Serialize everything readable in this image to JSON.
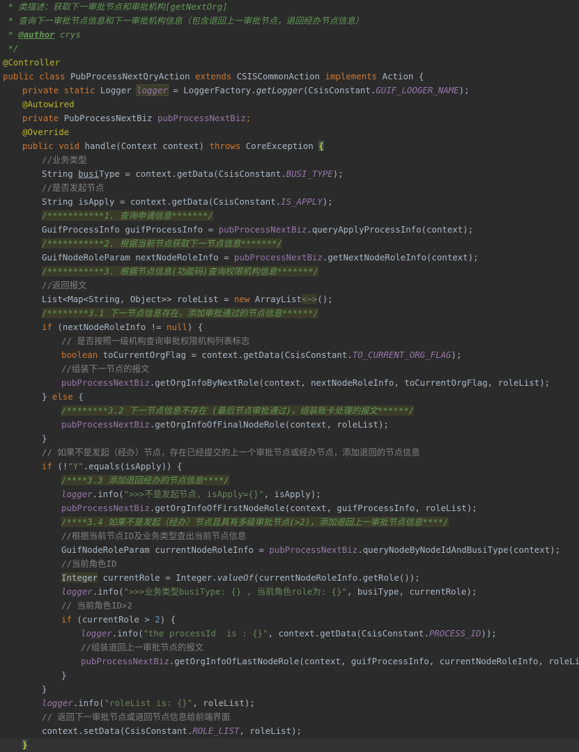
{
  "code_lines": [
    {
      "indent": 0,
      "tokens": [
        {
          "t": "doc",
          "v": " * 类描述：获取下一审批节点和审批机构[getNextOrg]"
        }
      ]
    },
    {
      "indent": 0,
      "tokens": [
        {
          "t": "doc",
          "v": " * 查询下一审批节点信息和下一审批机构信息（包含退回上一审批节点，退回经办节点信息）"
        }
      ]
    },
    {
      "indent": 0,
      "tokens": [
        {
          "t": "doc",
          "v": " * "
        },
        {
          "t": "doctag",
          "v": "@author"
        },
        {
          "t": "doc",
          "v": " crys"
        }
      ]
    },
    {
      "indent": 0,
      "tokens": [
        {
          "t": "doc",
          "v": " */"
        }
      ]
    },
    {
      "indent": 0,
      "tokens": [
        {
          "t": "ann",
          "v": "@Controller"
        }
      ]
    },
    {
      "indent": 0,
      "tokens": [
        {
          "t": "kw",
          "v": "public class "
        },
        {
          "t": "text",
          "v": "PubProcessNextQryAction "
        },
        {
          "t": "kw",
          "v": "extends "
        },
        {
          "t": "text",
          "v": "CSISCommonAction "
        },
        {
          "t": "kw",
          "v": "implements "
        },
        {
          "t": "text",
          "v": "Action {"
        }
      ]
    },
    {
      "indent": 1,
      "tokens": [
        {
          "t": "kw",
          "v": "private static "
        },
        {
          "t": "text",
          "v": "Logger "
        },
        {
          "t": "fieldbox",
          "v": "logger"
        },
        {
          "t": "text",
          "v": " = LoggerFactory."
        },
        {
          "t": "smeth",
          "v": "getLogger"
        },
        {
          "t": "text",
          "v": "(CsisConstant."
        },
        {
          "t": "sfield",
          "v": "GUIF_LOOGER_NAME"
        },
        {
          "t": "text",
          "v": ");"
        }
      ]
    },
    {
      "indent": 1,
      "tokens": [
        {
          "t": "ann",
          "v": "@Autowired"
        }
      ]
    },
    {
      "indent": 1,
      "tokens": [
        {
          "t": "kw",
          "v": "private "
        },
        {
          "t": "text",
          "v": "PubProcessNextBiz "
        },
        {
          "t": "field",
          "v": "pubProcessNextBiz"
        },
        {
          "t": "kw",
          "v": ";"
        }
      ]
    },
    {
      "indent": 1,
      "tokens": [
        {
          "t": "ann",
          "v": "@Override"
        }
      ]
    },
    {
      "indent": 1,
      "tokens": [
        {
          "t": "kw",
          "v": "public void "
        },
        {
          "t": "text",
          "v": "handle(Context context) "
        },
        {
          "t": "kw",
          "v": "throws "
        },
        {
          "t": "text",
          "v": "CoreException "
        },
        {
          "t": "brace",
          "v": "{"
        }
      ]
    },
    {
      "indent": 2,
      "tokens": [
        {
          "t": "com",
          "v": "//业务类型"
        }
      ]
    },
    {
      "indent": 2,
      "tokens": [
        {
          "t": "text",
          "v": "String "
        },
        {
          "t": "text-u",
          "v": "busi"
        },
        {
          "t": "text",
          "v": "Type = context.getData(CsisConstant."
        },
        {
          "t": "sfield",
          "v": "BUSI_TYPE"
        },
        {
          "t": "text",
          "v": ");"
        }
      ]
    },
    {
      "indent": 2,
      "tokens": [
        {
          "t": "com",
          "v": "//是否发起节点"
        }
      ]
    },
    {
      "indent": 2,
      "tokens": [
        {
          "t": "text",
          "v": "String isApply = context.getData(CsisConstant."
        },
        {
          "t": "sfield",
          "v": "IS_APPLY"
        },
        {
          "t": "text",
          "v": ");"
        }
      ]
    },
    {
      "indent": 2,
      "tokens": [
        {
          "t": "hl",
          "v": "/***********1. 查询申请信息*******/"
        }
      ]
    },
    {
      "indent": 2,
      "tokens": [
        {
          "t": "text",
          "v": "GuifProcessInfo guifProcessInfo = "
        },
        {
          "t": "field",
          "v": "pubProcessNextBiz"
        },
        {
          "t": "text",
          "v": ".queryApplyProcessInfo(context);"
        }
      ]
    },
    {
      "indent": 2,
      "tokens": [
        {
          "t": "hl",
          "v": "/***********2. 根据当前节点获取下一节点信息*******/"
        }
      ]
    },
    {
      "indent": 2,
      "tokens": [
        {
          "t": "text",
          "v": "GuifNodeRoleParam nextNodeRoleInfo = "
        },
        {
          "t": "field",
          "v": "pubProcessNextBiz"
        },
        {
          "t": "text",
          "v": ".getNextNodeRoleInfo(context);"
        }
      ]
    },
    {
      "indent": 2,
      "tokens": [
        {
          "t": "hl",
          "v": "/***********3. 根据节点信息(功能码)查询权限机构信息*******/"
        }
      ]
    },
    {
      "indent": 2,
      "tokens": [
        {
          "t": "com",
          "v": "//返回报文"
        }
      ]
    },
    {
      "indent": 2,
      "tokens": [
        {
          "t": "text",
          "v": "List<Map<String, Object>> roleList = "
        },
        {
          "t": "kw",
          "v": "new "
        },
        {
          "t": "text",
          "v": "ArrayList"
        },
        {
          "t": "diamond",
          "v": "<~>"
        },
        {
          "t": "text",
          "v": "();"
        }
      ]
    },
    {
      "indent": 2,
      "tokens": [
        {
          "t": "hl",
          "v": "/********3.1 下一节点信息存在，添加审批通过的节点信息******/"
        }
      ]
    },
    {
      "indent": 2,
      "tokens": [
        {
          "t": "kw",
          "v": "if "
        },
        {
          "t": "text",
          "v": "(nextNodeRoleInfo != "
        },
        {
          "t": "kw",
          "v": "null"
        },
        {
          "t": "text",
          "v": ") {"
        }
      ]
    },
    {
      "indent": 3,
      "tokens": [
        {
          "t": "com",
          "v": "// 是否按照一级机构查询审批权限机构列表标志"
        }
      ]
    },
    {
      "indent": 3,
      "tokens": [
        {
          "t": "kw",
          "v": "boolean "
        },
        {
          "t": "text",
          "v": "toCurrentOrgFlag = context.getData(CsisConstant."
        },
        {
          "t": "sfield",
          "v": "TO_CURRENT_ORG_FLAG"
        },
        {
          "t": "text",
          "v": ");"
        }
      ]
    },
    {
      "indent": 3,
      "tokens": [
        {
          "t": "com",
          "v": "//组装下一节点的报文"
        }
      ]
    },
    {
      "indent": 3,
      "tokens": [
        {
          "t": "field",
          "v": "pubProcessNextBiz"
        },
        {
          "t": "text",
          "v": ".getOrgInfoByNextRole(context, nextNodeRoleInfo, toCurrentOrgFlag, roleList);"
        }
      ]
    },
    {
      "indent": 2,
      "tokens": [
        {
          "t": "text",
          "v": "} "
        },
        {
          "t": "kw",
          "v": "else "
        },
        {
          "t": "text",
          "v": "{"
        }
      ]
    },
    {
      "indent": 3,
      "tokens": [
        {
          "t": "hl",
          "v": "/********3.2 下一节点信息不存在 (最后节点审批通过)，组装账卡处理的报文******/"
        }
      ]
    },
    {
      "indent": 3,
      "tokens": [
        {
          "t": "field",
          "v": "pubProcessNextBiz"
        },
        {
          "t": "text",
          "v": ".getOrgInfoOfFinalNodeRole(context, roleList);"
        }
      ]
    },
    {
      "indent": 2,
      "tokens": [
        {
          "t": "text",
          "v": "}"
        }
      ]
    },
    {
      "indent": 2,
      "tokens": [
        {
          "t": "com",
          "v": "// 如果不是发起（经办）节点，存在已经提交的上一个审批节点或经办节点，添加退回的节点信息"
        }
      ]
    },
    {
      "indent": 2,
      "tokens": [
        {
          "t": "kw",
          "v": "if "
        },
        {
          "t": "text",
          "v": "(!"
        },
        {
          "t": "str",
          "v": "\"Y\""
        },
        {
          "t": "text",
          "v": ".equals(isApply)) {"
        }
      ]
    },
    {
      "indent": 3,
      "tokens": [
        {
          "t": "hl",
          "v": "/****3.3 添加退回经办的节点信息****/"
        }
      ]
    },
    {
      "indent": 3,
      "tokens": [
        {
          "t": "sfield",
          "v": "logger"
        },
        {
          "t": "text",
          "v": ".info("
        },
        {
          "t": "str",
          "v": "\">>>不是发起节点, isApply={}\""
        },
        {
          "t": "text",
          "v": ", isApply);"
        }
      ]
    },
    {
      "indent": 3,
      "tokens": [
        {
          "t": "field",
          "v": "pubProcessNextBiz"
        },
        {
          "t": "text",
          "v": ".getOrgInfoOfFirstNodeRole(context, guifProcessInfo, roleList);"
        }
      ]
    },
    {
      "indent": 3,
      "tokens": [
        {
          "t": "hl",
          "v": "/****3.4 如果不是发起（经办）节点且具有多级审批节点(>2)，添加退回上一审批节点信息****/"
        }
      ]
    },
    {
      "indent": 3,
      "tokens": [
        {
          "t": "com",
          "v": "//根据当前节点ID及业务类型查出当前节点信息"
        }
      ]
    },
    {
      "indent": 3,
      "tokens": [
        {
          "t": "text",
          "v": "GuifNodeRoleParam currentNodeRoleInfo = "
        },
        {
          "t": "field",
          "v": "pubProcessNextBiz"
        },
        {
          "t": "text",
          "v": ".queryNodeByNodeIdAndBusiType(context);"
        }
      ]
    },
    {
      "indent": 3,
      "tokens": [
        {
          "t": "com",
          "v": "//当前角色ID"
        }
      ]
    },
    {
      "indent": 3,
      "tokens": [
        {
          "t": "typebox",
          "v": "Integer"
        },
        {
          "t": "text",
          "v": " currentRole = Integer."
        },
        {
          "t": "smeth",
          "v": "valueOf"
        },
        {
          "t": "text",
          "v": "(currentNodeRoleInfo.getRole());"
        }
      ]
    },
    {
      "indent": 3,
      "tokens": [
        {
          "t": "sfield",
          "v": "logger"
        },
        {
          "t": "text",
          "v": ".info("
        },
        {
          "t": "str",
          "v": "\">>>业务类型busiType: {} , 当前角色role为: {}\""
        },
        {
          "t": "text",
          "v": ", busiType, currentRole);"
        }
      ]
    },
    {
      "indent": 3,
      "tokens": [
        {
          "t": "com",
          "v": "// 当前角色ID>2"
        }
      ]
    },
    {
      "indent": 3,
      "tokens": [
        {
          "t": "kw",
          "v": "if "
        },
        {
          "t": "text",
          "v": "(currentRole > "
        },
        {
          "t": "num",
          "v": "2"
        },
        {
          "t": "text",
          "v": ") {"
        }
      ]
    },
    {
      "indent": 4,
      "tokens": [
        {
          "t": "sfield",
          "v": "logger"
        },
        {
          "t": "text",
          "v": ".info("
        },
        {
          "t": "str",
          "v": "\"the processId  is : {}\""
        },
        {
          "t": "text",
          "v": ", context.getData(CsisConstant."
        },
        {
          "t": "sfield",
          "v": "PROCESS_ID"
        },
        {
          "t": "text",
          "v": "));"
        }
      ]
    },
    {
      "indent": 4,
      "tokens": [
        {
          "t": "com",
          "v": "//组装退回上一审批节点的报文"
        }
      ]
    },
    {
      "indent": 4,
      "tokens": [
        {
          "t": "field",
          "v": "pubProcessNextBiz"
        },
        {
          "t": "text",
          "v": ".getOrgInfoOfLastNodeRole(context, guifProcessInfo, currentNodeRoleInfo, roleList);"
        }
      ]
    },
    {
      "indent": 3,
      "tokens": [
        {
          "t": "text",
          "v": "}"
        }
      ]
    },
    {
      "indent": 2,
      "tokens": [
        {
          "t": "text",
          "v": "}"
        }
      ]
    },
    {
      "indent": 2,
      "tokens": [
        {
          "t": "sfield",
          "v": "logger"
        },
        {
          "t": "text",
          "v": ".info("
        },
        {
          "t": "str",
          "v": "\"roleList is: {}\""
        },
        {
          "t": "text",
          "v": ", roleList);"
        }
      ]
    },
    {
      "indent": 2,
      "tokens": [
        {
          "t": "com",
          "v": "// 返回下一审批节点或退回节点信息给前端界面"
        }
      ]
    },
    {
      "indent": 2,
      "tokens": [
        {
          "t": "text",
          "v": "context.setData(CsisConstant."
        },
        {
          "t": "sfield",
          "v": "ROLE_LIST"
        },
        {
          "t": "text",
          "v": ", roleList);"
        }
      ]
    },
    {
      "indent": 1,
      "current": true,
      "tokens": [
        {
          "t": "brace",
          "v": "}"
        }
      ]
    }
  ]
}
